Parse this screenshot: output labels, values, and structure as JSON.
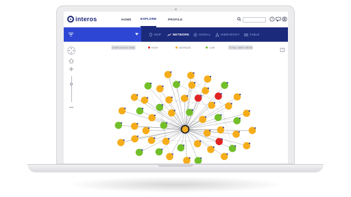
{
  "app": {
    "brand": "interos",
    "top_nav": [
      {
        "label": "HOME",
        "active": false
      },
      {
        "label": "EXPLORE",
        "active": true
      },
      {
        "label": "PROFILE",
        "active": false
      }
    ],
    "search": {
      "placeholder": ""
    },
    "header_icons": [
      "search-icon",
      "help-icon",
      "chat-icon",
      "user-icon"
    ]
  },
  "navbar": {
    "filter_icon": "filter-icon",
    "views": [
      {
        "label": "MAP",
        "icon": "map-pin-icon",
        "active": false
      },
      {
        "label": "NETWORK",
        "icon": "network-icon",
        "active": true
      },
      {
        "label": "SIGNAL",
        "icon": "signal-icon",
        "active": false
      },
      {
        "label": "HIERARCHY",
        "icon": "hierarchy-icon",
        "active": false
      },
      {
        "label": "TABLE",
        "icon": "table-icon",
        "active": false
      }
    ]
  },
  "toolbar": {
    "left_pill": "DISPLAYING BNB",
    "right_pill": "TOTAL NEW ORGS",
    "legend": [
      {
        "label": "HIGH",
        "color": "#e02424"
      },
      {
        "label": "AVERAGE",
        "color": "#f5ad1b"
      },
      {
        "label": "LOW",
        "color": "#72bf2a"
      }
    ]
  },
  "colors": {
    "accent": "#1c2a7c",
    "accent_light": "#2d47d4",
    "risk_high": "#e02424",
    "risk_average": "#f5ad1b",
    "risk_low": "#72bf2a"
  },
  "network": {
    "hub_label": "",
    "nodes": [
      {
        "risk": "average"
      },
      {
        "risk": "average"
      },
      {
        "risk": "low"
      },
      {
        "risk": "average"
      },
      {
        "risk": "low"
      },
      {
        "risk": "average"
      },
      {
        "risk": "low"
      },
      {
        "risk": "average"
      },
      {
        "risk": "average"
      },
      {
        "risk": "high"
      },
      {
        "risk": "average"
      },
      {
        "risk": "low"
      },
      {
        "risk": "average"
      },
      {
        "risk": "average"
      },
      {
        "risk": "low"
      },
      {
        "risk": "average"
      },
      {
        "risk": "average"
      },
      {
        "risk": "average"
      },
      {
        "risk": "low"
      },
      {
        "risk": "average"
      },
      {
        "risk": "average"
      },
      {
        "risk": "high"
      },
      {
        "risk": "average"
      },
      {
        "risk": "low"
      },
      {
        "risk": "average"
      },
      {
        "risk": "low"
      },
      {
        "risk": "average"
      },
      {
        "risk": "average"
      },
      {
        "risk": "low"
      },
      {
        "risk": "average"
      },
      {
        "risk": "average"
      },
      {
        "risk": "average"
      },
      {
        "risk": "low"
      },
      {
        "risk": "average"
      },
      {
        "risk": "average"
      },
      {
        "risk": "low"
      },
      {
        "risk": "average"
      },
      {
        "risk": "average"
      },
      {
        "risk": "low"
      },
      {
        "risk": "average"
      },
      {
        "risk": "average"
      },
      {
        "risk": "high"
      },
      {
        "risk": "average"
      },
      {
        "risk": "low"
      },
      {
        "risk": "average"
      },
      {
        "risk": "average"
      },
      {
        "risk": "average"
      },
      {
        "risk": "low"
      },
      {
        "risk": "average"
      },
      {
        "risk": "average"
      },
      {
        "risk": "low"
      },
      {
        "risk": "average"
      },
      {
        "risk": "average"
      },
      {
        "risk": "average"
      },
      {
        "risk": "low"
      },
      {
        "risk": "average"
      },
      {
        "risk": "average"
      },
      {
        "risk": "low"
      },
      {
        "risk": "average"
      },
      {
        "risk": "average"
      },
      {
        "risk": "average"
      },
      {
        "risk": "low"
      },
      {
        "risk": "average"
      },
      {
        "risk": "average"
      }
    ]
  }
}
